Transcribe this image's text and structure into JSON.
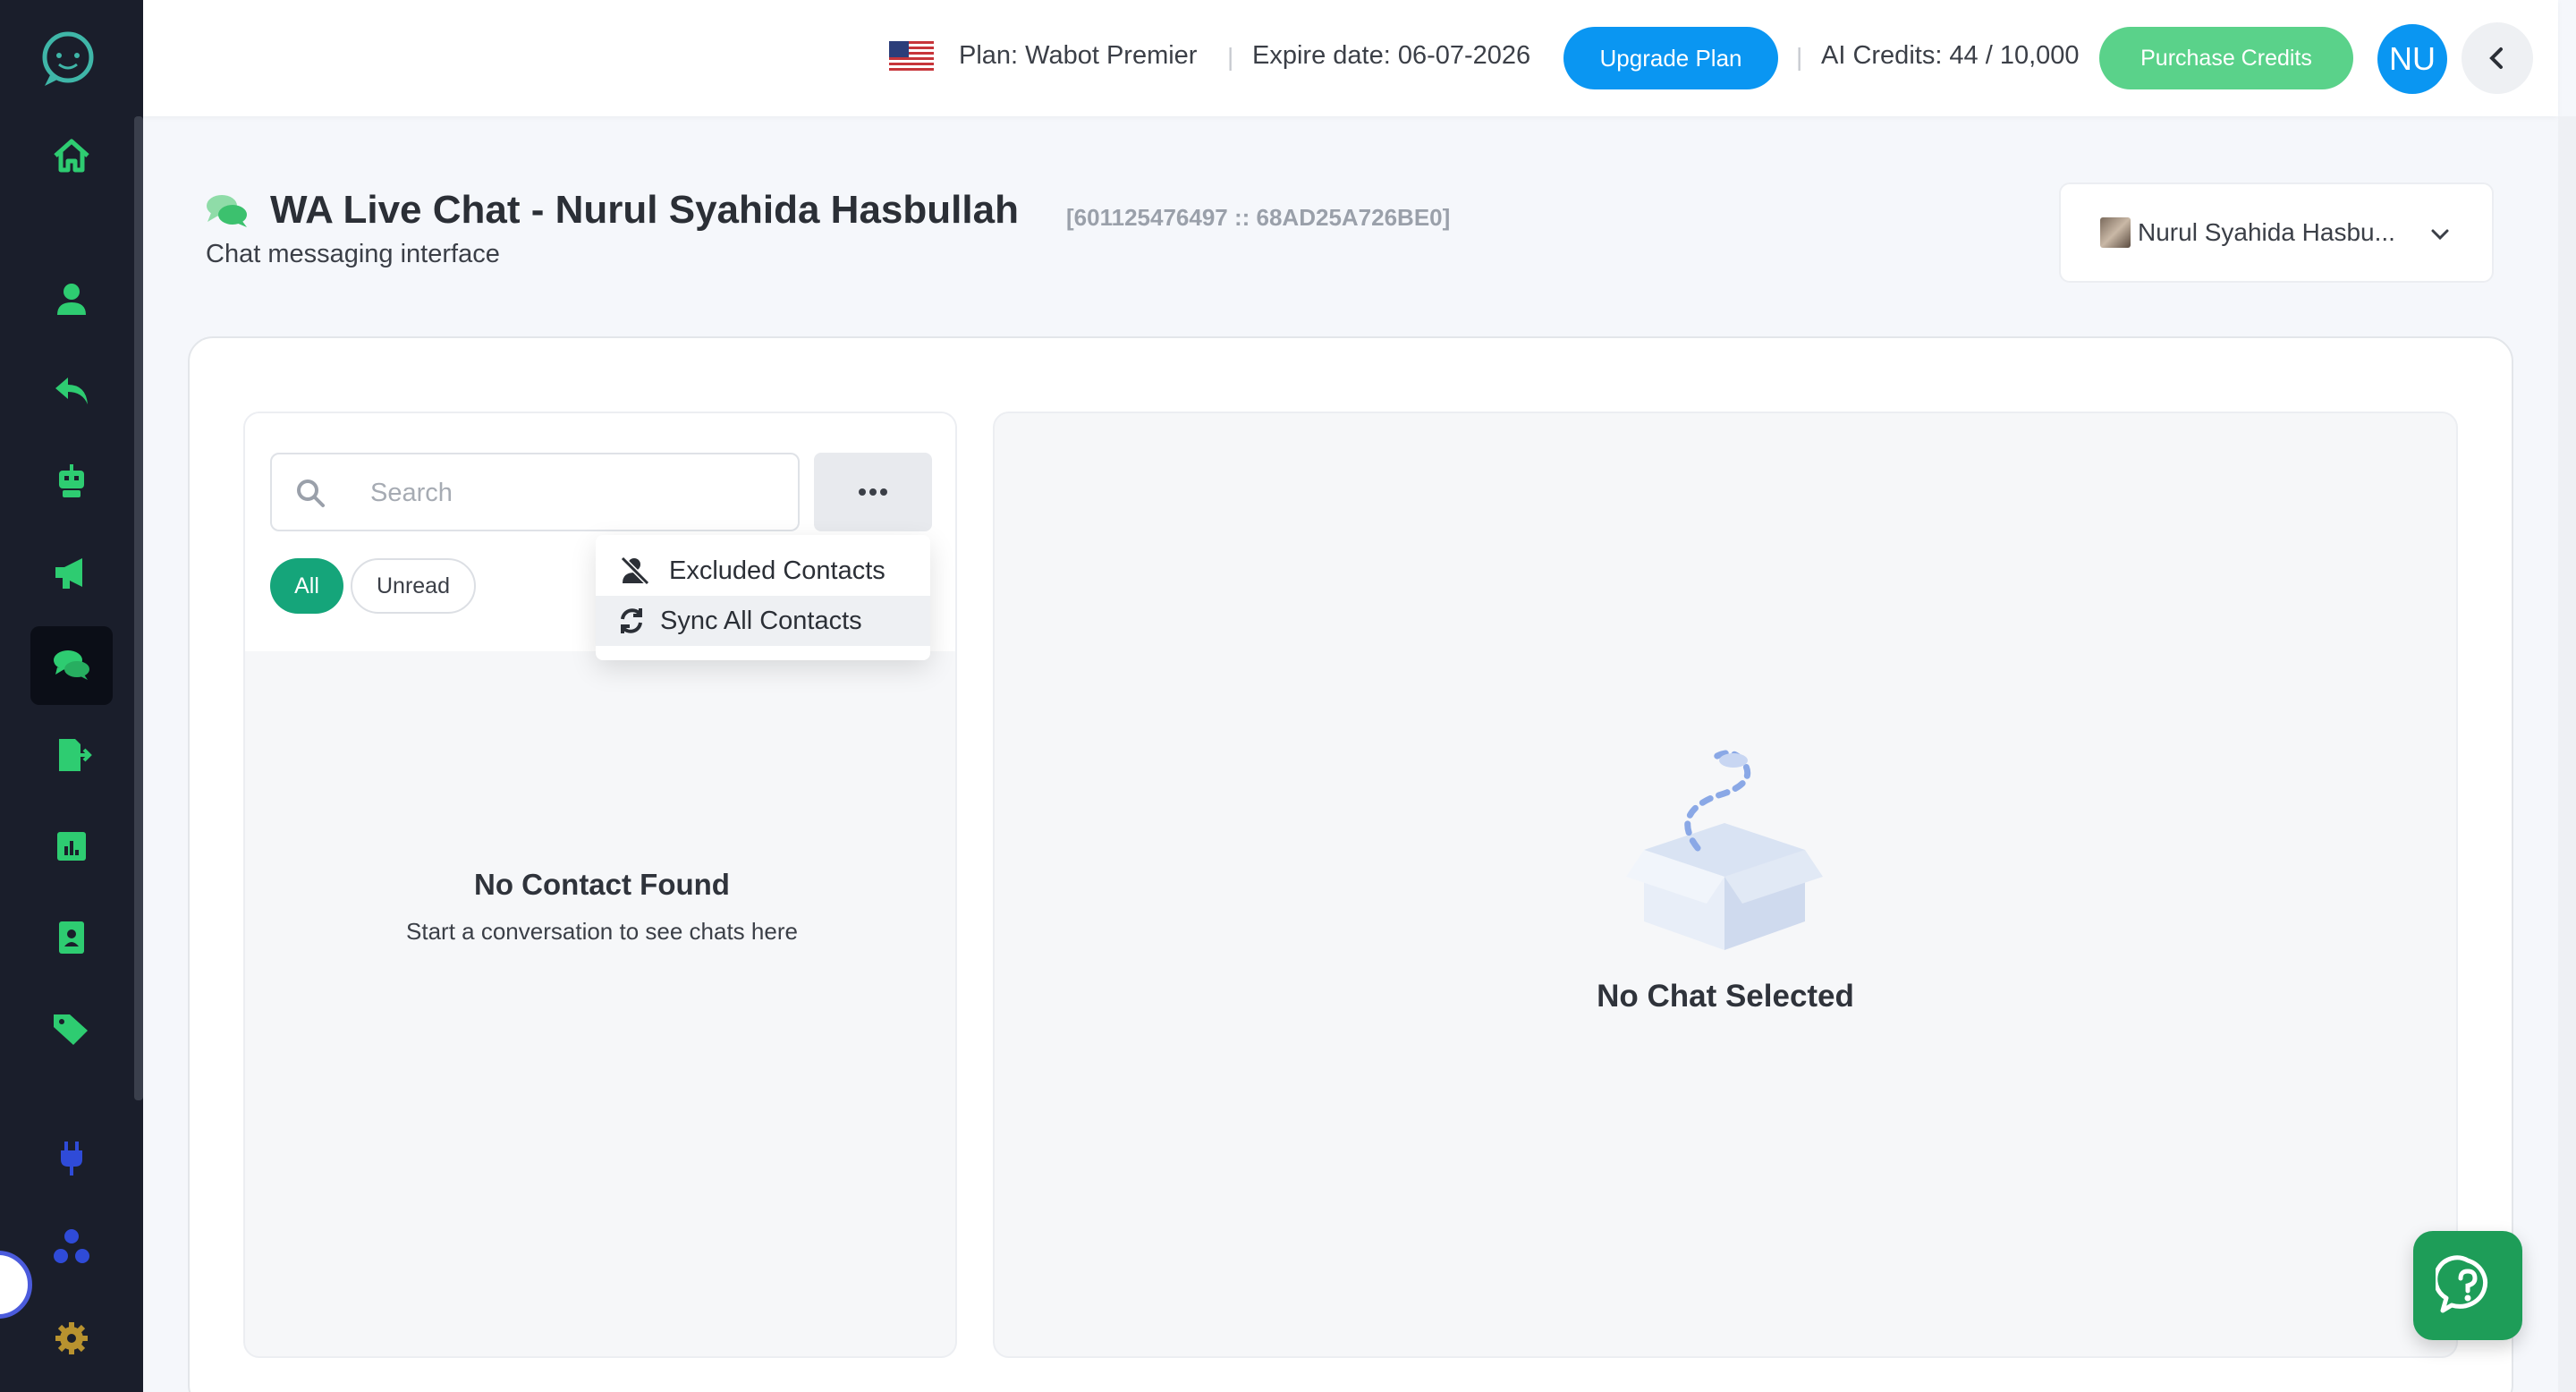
{
  "topbar": {
    "plan": "Plan: Wabot Premier",
    "expire": "Expire date: 06-07-2026",
    "upgrade_label": "Upgrade Plan",
    "credits": "AI Credits: 44 / 10,000",
    "purchase_label": "Purchase Credits",
    "avatar_initials": "NU",
    "separator": "|"
  },
  "sidebar": {
    "items": [
      "home-icon",
      "contacts-icon",
      "reply-icon",
      "bot-icon",
      "broadcast-icon",
      "live-chat-icon",
      "export-icon",
      "reports-icon",
      "address-book-icon",
      "tags-icon",
      "plug-icon",
      "network-icon",
      "settings-icon"
    ],
    "active": "live-chat-icon",
    "accent": "#2ecc71"
  },
  "page": {
    "title": "WA Live Chat  - Nurul Syahida Hasbullah",
    "ids": "[601125476497 :: 68AD25A726BE0]",
    "subtitle": "Chat messaging interface"
  },
  "account_select": {
    "value": "Nurul Syahida Hasbu..."
  },
  "contacts": {
    "search_placeholder": "Search",
    "filters": [
      "All",
      "Unread"
    ],
    "empty_title": "No Contact Found",
    "empty_subtitle": "Start a conversation to see chats here"
  },
  "menu": {
    "items": [
      "Excluded Contacts",
      "Sync All Contacts"
    ]
  },
  "chat": {
    "empty_title": "No Chat Selected"
  },
  "colors": {
    "upgrade": "#0a96f2",
    "purchase": "#5ad28a",
    "filter_active": "#15a57a",
    "help": "#1e9d58"
  }
}
